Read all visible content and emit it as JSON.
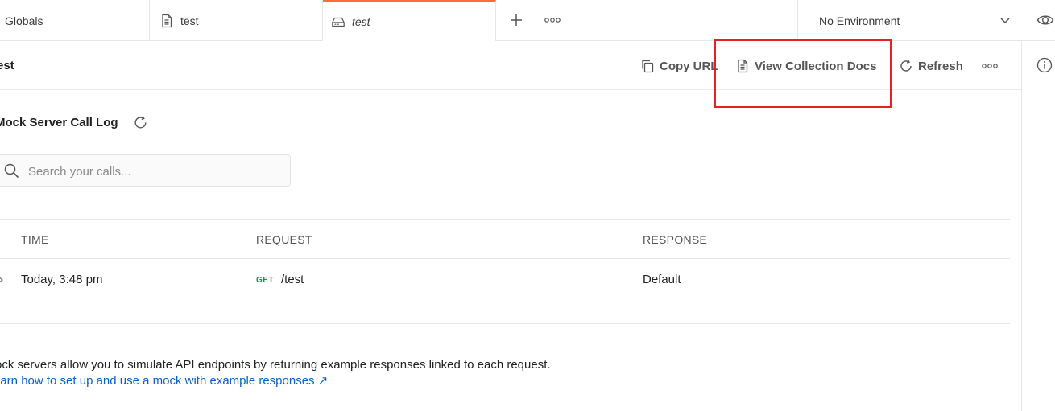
{
  "tabs": [
    {
      "label": "Globals",
      "icon": "globe-icon"
    },
    {
      "label": "test",
      "icon": "document-icon"
    },
    {
      "label": "test",
      "icon": "mock-server-icon",
      "active": true
    }
  ],
  "tab_actions": {
    "add_icon": "plus-icon",
    "more_icon": "more-horizontal-icon"
  },
  "environment": {
    "selected": "No Environment",
    "icon": "chevron-down-icon"
  },
  "header": {
    "title": "est",
    "copy_url_label": "Copy URL",
    "view_docs_label": "View Collection Docs",
    "refresh_label": "Refresh"
  },
  "call_log": {
    "title": "Mock Server Call Log",
    "search_placeholder": "Search your calls..."
  },
  "table": {
    "columns": [
      "TIME",
      "REQUEST",
      "RESPONSE"
    ],
    "rows": [
      {
        "time": "Today, 3:48 pm",
        "method": "GET",
        "path": "/test",
        "response": "Default"
      }
    ]
  },
  "footer": {
    "description": "ock servers allow you to simulate API endpoints by returning example responses linked to each request.",
    "link": "earn how to set up and use a mock with example responses ↗"
  },
  "colors": {
    "accent": "#ff6c37",
    "highlight": "#e8201f",
    "link": "#0b62c4",
    "get_method": "#0a9a4a"
  }
}
